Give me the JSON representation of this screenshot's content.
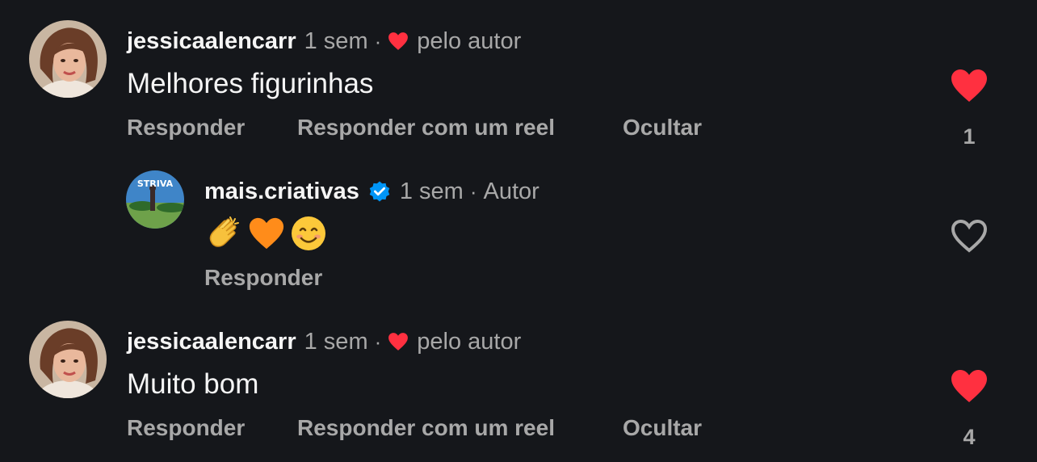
{
  "colors": {
    "background": "#15171b",
    "text_primary": "#f5f5f5",
    "text_secondary": "#a8a8a8",
    "like_red": "#ff3040",
    "verified_blue": "#0095f6"
  },
  "comments": [
    {
      "username": "jessicaalencarr",
      "time": "1 sem",
      "liked_by_author_label": "pelo autor",
      "text": "Melhores figurinhas",
      "actions": {
        "reply": "Responder",
        "reply_reel": "Responder com um reel",
        "hide": "Ocultar"
      },
      "liked": true,
      "like_count": "1"
    },
    {
      "username": "mais.criativas",
      "verified": true,
      "time": "1 sem",
      "author_badge": "Autor",
      "text_emojis": [
        "clapping-hands",
        "orange-heart",
        "smiling-face"
      ],
      "actions": {
        "reply": "Responder"
      },
      "liked": false
    },
    {
      "username": "jessicaalencarr",
      "time": "1 sem",
      "liked_by_author_label": "pelo autor",
      "text": "Muito bom",
      "actions": {
        "reply": "Responder",
        "reply_reel": "Responder com um reel",
        "hide": "Ocultar"
      },
      "liked": true,
      "like_count": "4"
    }
  ]
}
